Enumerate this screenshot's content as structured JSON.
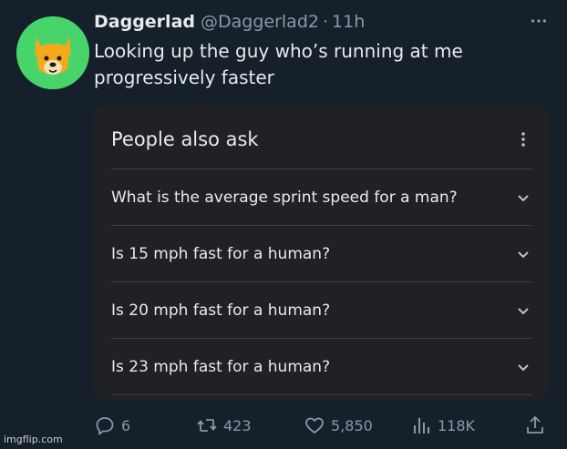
{
  "tweet": {
    "display_name": "Daggerlad",
    "handle": "@Daggerlad2",
    "separator": "·",
    "time": "11h",
    "text_line1": "Looking up the guy who’s running at me",
    "text_line2": "progressively faster",
    "more_icon": "more-horizontal-icon"
  },
  "card": {
    "title": "People also ask",
    "questions": [
      "What is the average sprint speed for a man?",
      "Is 15 mph fast for a human?",
      "Is 20 mph fast for a human?",
      "Is 23 mph fast for a human?"
    ]
  },
  "actions": {
    "replies": "6",
    "retweets": "423",
    "likes": "5,850",
    "views": "118K"
  },
  "watermark": "imgflip.com",
  "colors": {
    "background": "#15202b",
    "card": "#202124",
    "avatar": "#47d56b",
    "muted": "#8b98a5"
  }
}
